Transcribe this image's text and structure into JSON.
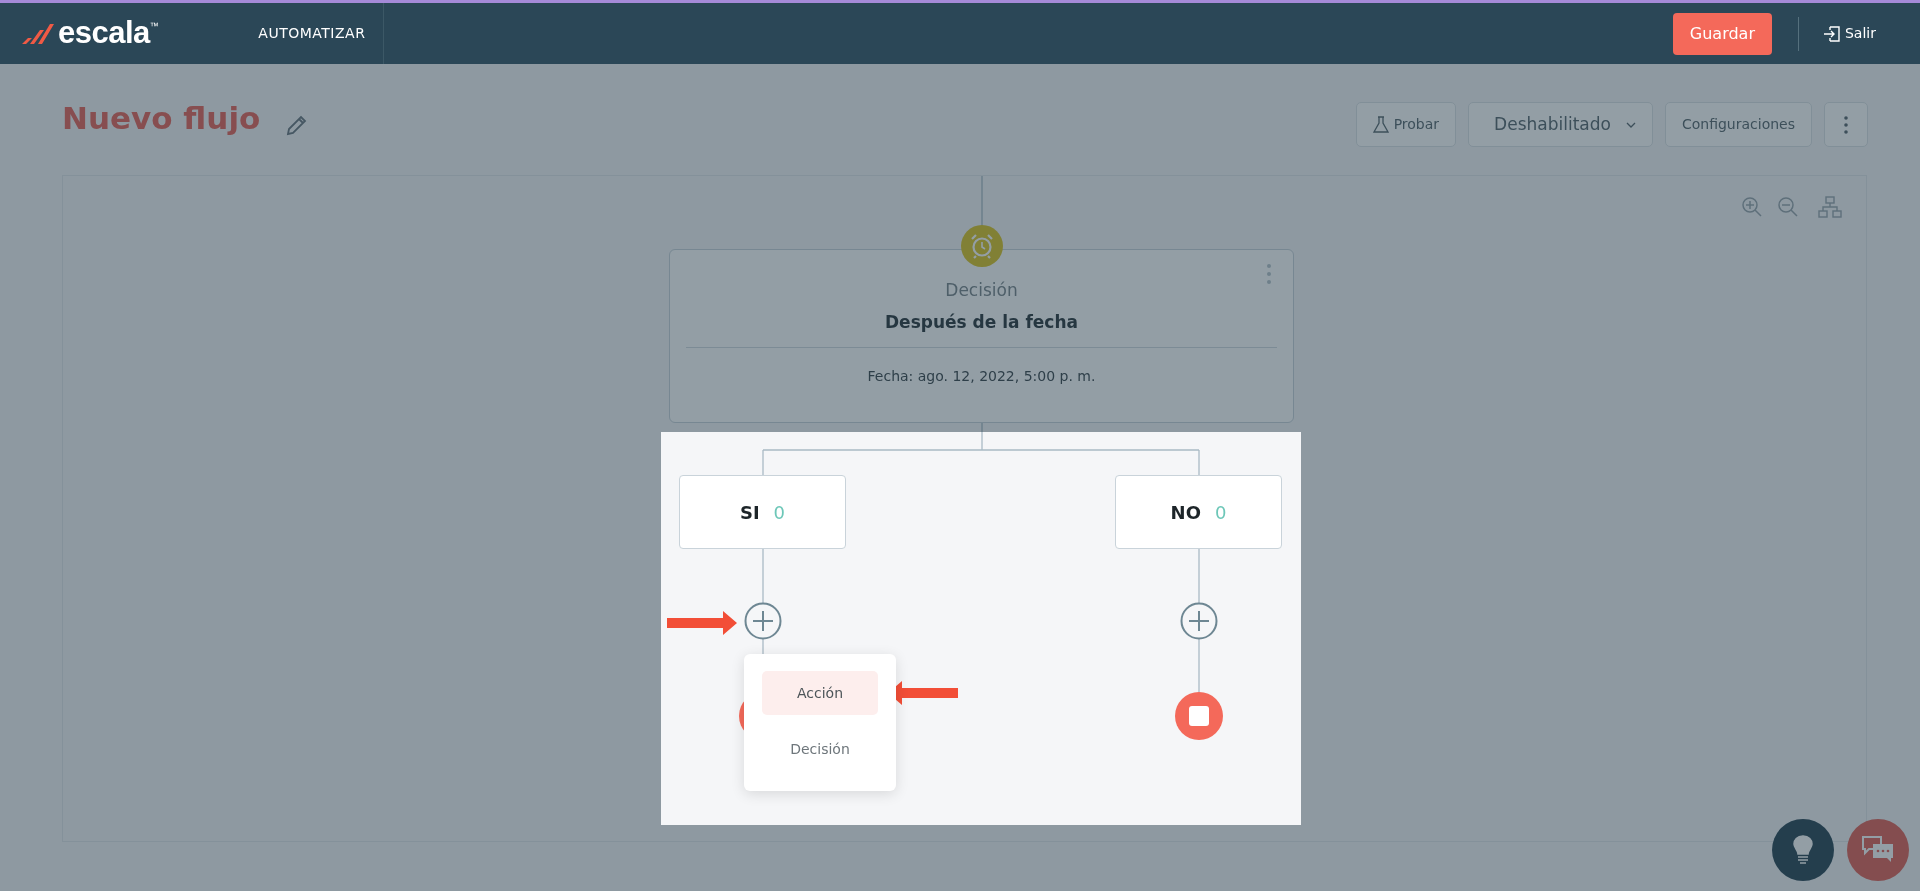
{
  "header": {
    "brand": "escala",
    "brand_mark": "™",
    "section": "AUTOMATIZAR",
    "save_button": "Guardar",
    "exit_link": "Salir"
  },
  "title": "Nuevo flujo",
  "toolbar": {
    "test_button": "Probar",
    "status_dropdown": "Deshabilitado",
    "settings_button": "Configuraciones"
  },
  "decision_node": {
    "type": "Decisión",
    "title": "Después de la fecha",
    "detail": "Fecha: ago. 12, 2022, 5:00 p. m."
  },
  "branches": [
    {
      "label": "SI",
      "count": "0",
      "menu_open": true,
      "menu_items": [
        {
          "label": "Acción",
          "selected": true
        },
        {
          "label": "Decisión",
          "selected": false
        }
      ]
    },
    {
      "label": "NO",
      "count": "0",
      "menu_open": false
    }
  ]
}
